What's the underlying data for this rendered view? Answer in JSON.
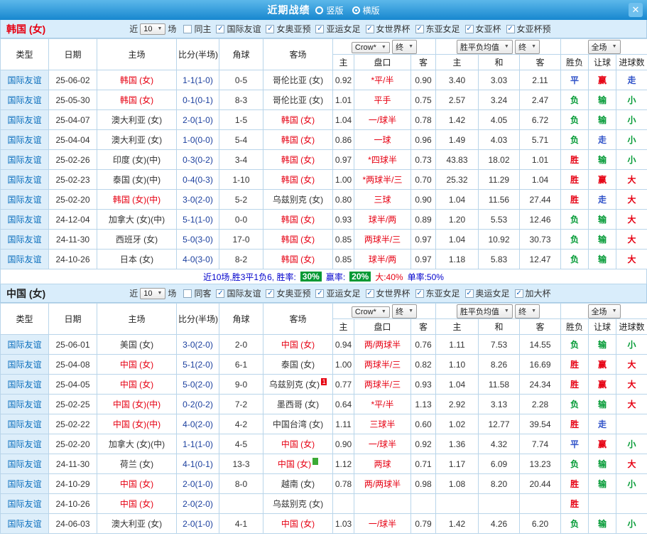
{
  "icons": {
    "close": "✕",
    "check": "✓",
    "dropdown_arrow": "▼"
  },
  "result_colors": {
    "胜": "#e60012",
    "负": "#009933",
    "平": "#2d50c8",
    "赢": "#e60012",
    "输": "#009933",
    "走": "#2d50c8",
    "大": "#e60012",
    "小": "#009933"
  },
  "titlebar": {
    "title": "近期战绩",
    "radios": [
      {
        "label": "竖版",
        "selected": false
      },
      {
        "label": "横版",
        "selected": true
      }
    ]
  },
  "sections": [
    {
      "team": "韩国 (女)",
      "team_color": "#e60012",
      "filter": {
        "prefix": "近",
        "count": "10",
        "suffix": "场",
        "checkboxes": [
          {
            "label": "同主",
            "checked": false
          },
          {
            "label": "国际友谊",
            "checked": true
          },
          {
            "label": "女奥亚预",
            "checked": true
          },
          {
            "label": "亚运女足",
            "checked": true
          },
          {
            "label": "女世界杯",
            "checked": true
          },
          {
            "label": "东亚女足",
            "checked": true
          },
          {
            "label": "女亚杯",
            "checked": true
          },
          {
            "label": "女亚杯预",
            "checked": true
          }
        ]
      },
      "controls": {
        "bookmaker": "Crow*",
        "final_a": "终",
        "europe_avg": "胜平负均值",
        "final_b": "终",
        "scope": "全场"
      },
      "columns": {
        "type": "类型",
        "date": "日期",
        "home": "主场",
        "score": "比分(半场)",
        "corner": "角球",
        "away": "客场",
        "asia": [
          "主",
          "盘口",
          "客"
        ],
        "europe": [
          "主",
          "和",
          "客"
        ],
        "result": [
          "胜负",
          "让球",
          "进球数"
        ]
      },
      "rows": [
        {
          "type": "国际友谊",
          "date": "25-06-02",
          "home": {
            "name": "韩国 (女)",
            "hl": true
          },
          "score": "1-1(1-0)",
          "corner": "0-5",
          "away": {
            "name": "哥伦比亚 (女)",
            "hl": false
          },
          "asia": [
            "0.92",
            "*平/半",
            "0.90"
          ],
          "europe": [
            "3.40",
            "3.03",
            "2.11"
          ],
          "results": [
            "平",
            "赢",
            "走"
          ]
        },
        {
          "type": "国际友谊",
          "date": "25-05-30",
          "home": {
            "name": "韩国 (女)",
            "hl": true
          },
          "score": "0-1(0-1)",
          "corner": "8-3",
          "away": {
            "name": "哥伦比亚 (女)",
            "hl": false
          },
          "asia": [
            "1.01",
            "平手",
            "0.75"
          ],
          "europe": [
            "2.57",
            "3.24",
            "2.47"
          ],
          "results": [
            "负",
            "输",
            "小"
          ]
        },
        {
          "type": "国际友谊",
          "date": "25-04-07",
          "home": {
            "name": "澳大利亚 (女)",
            "hl": false
          },
          "score": "2-0(1-0)",
          "corner": "1-5",
          "away": {
            "name": "韩国 (女)",
            "hl": true
          },
          "asia": [
            "1.04",
            "一/球半",
            "0.78"
          ],
          "europe": [
            "1.42",
            "4.05",
            "6.72"
          ],
          "results": [
            "负",
            "输",
            "小"
          ]
        },
        {
          "type": "国际友谊",
          "date": "25-04-04",
          "home": {
            "name": "澳大利亚 (女)",
            "hl": false
          },
          "score": "1-0(0-0)",
          "corner": "5-4",
          "away": {
            "name": "韩国 (女)",
            "hl": true
          },
          "asia": [
            "0.86",
            "一球",
            "0.96"
          ],
          "europe": [
            "1.49",
            "4.03",
            "5.71"
          ],
          "results": [
            "负",
            "走",
            "小"
          ]
        },
        {
          "type": "国际友谊",
          "date": "25-02-26",
          "home": {
            "name": "印度 (女)(中)",
            "hl": false
          },
          "score": "0-3(0-2)",
          "corner": "3-4",
          "away": {
            "name": "韩国 (女)",
            "hl": true
          },
          "asia": [
            "0.97",
            "*四球半",
            "0.73"
          ],
          "europe": [
            "43.83",
            "18.02",
            "1.01"
          ],
          "results": [
            "胜",
            "输",
            "小"
          ]
        },
        {
          "type": "国际友谊",
          "date": "25-02-23",
          "home": {
            "name": "泰国 (女)(中)",
            "hl": false
          },
          "score": "0-4(0-3)",
          "corner": "1-10",
          "away": {
            "name": "韩国 (女)",
            "hl": true
          },
          "asia": [
            "1.00",
            "*两球半/三",
            "0.70"
          ],
          "europe": [
            "25.32",
            "11.29",
            "1.04"
          ],
          "results": [
            "胜",
            "赢",
            "大"
          ]
        },
        {
          "type": "国际友谊",
          "date": "25-02-20",
          "home": {
            "name": "韩国 (女)(中)",
            "hl": true
          },
          "score": "3-0(2-0)",
          "corner": "5-2",
          "away": {
            "name": "乌兹别克 (女)",
            "hl": false
          },
          "asia": [
            "0.80",
            "三球",
            "0.90"
          ],
          "europe": [
            "1.04",
            "11.56",
            "27.44"
          ],
          "results": [
            "胜",
            "走",
            "大"
          ]
        },
        {
          "type": "国际友谊",
          "date": "24-12-04",
          "home": {
            "name": "加拿大 (女)(中)",
            "hl": false
          },
          "score": "5-1(1-0)",
          "corner": "0-0",
          "away": {
            "name": "韩国 (女)",
            "hl": true
          },
          "asia": [
            "0.93",
            "球半/两",
            "0.89"
          ],
          "europe": [
            "1.20",
            "5.53",
            "12.46"
          ],
          "results": [
            "负",
            "输",
            "大"
          ]
        },
        {
          "type": "国际友谊",
          "date": "24-11-30",
          "home": {
            "name": "西班牙 (女)",
            "hl": false
          },
          "score": "5-0(3-0)",
          "corner": "17-0",
          "away": {
            "name": "韩国 (女)",
            "hl": true
          },
          "asia": [
            "0.85",
            "两球半/三",
            "0.97"
          ],
          "europe": [
            "1.04",
            "10.92",
            "30.73"
          ],
          "results": [
            "负",
            "输",
            "大"
          ]
        },
        {
          "type": "国际友谊",
          "date": "24-10-26",
          "home": {
            "name": "日本 (女)",
            "hl": false
          },
          "score": "4-0(3-0)",
          "corner": "8-2",
          "away": {
            "name": "韩国 (女)",
            "hl": true
          },
          "asia": [
            "0.85",
            "球半/两",
            "0.97"
          ],
          "europe": [
            "1.18",
            "5.83",
            "12.47"
          ],
          "results": [
            "负",
            "输",
            "大"
          ]
        }
      ],
      "summary": {
        "lead": "近10场,胜3平1负6, 胜率:",
        "rate1": "30%",
        "mid": "赢率:",
        "rate2": "20%",
        "big": "大:40%",
        "single": "单率:50%"
      }
    },
    {
      "team": "中国 (女)",
      "team_color": "#222222",
      "filter": {
        "prefix": "近",
        "count": "10",
        "suffix": "场",
        "checkboxes": [
          {
            "label": "同客",
            "checked": false
          },
          {
            "label": "国际友谊",
            "checked": true
          },
          {
            "label": "女奥亚预",
            "checked": true
          },
          {
            "label": "亚运女足",
            "checked": true
          },
          {
            "label": "女世界杯",
            "checked": true
          },
          {
            "label": "东亚女足",
            "checked": true
          },
          {
            "label": "奥运女足",
            "checked": true
          },
          {
            "label": "加大杯",
            "checked": true
          }
        ]
      },
      "controls": {
        "bookmaker": "Crow*",
        "final_a": "终",
        "europe_avg": "胜平负均值",
        "final_b": "终",
        "scope": "全场"
      },
      "columns": {
        "type": "类型",
        "date": "日期",
        "home": "主场",
        "score": "比分(半场)",
        "corner": "角球",
        "away": "客场",
        "asia": [
          "主",
          "盘口",
          "客"
        ],
        "europe": [
          "主",
          "和",
          "客"
        ],
        "result": [
          "胜负",
          "让球",
          "进球数"
        ]
      },
      "rows": [
        {
          "type": "国际友谊",
          "date": "25-06-01",
          "home": {
            "name": "美国 (女)",
            "hl": false
          },
          "score": "3-0(2-0)",
          "corner": "2-0",
          "away": {
            "name": "中国 (女)",
            "hl": true
          },
          "asia": [
            "0.94",
            "两/两球半",
            "0.76"
          ],
          "europe": [
            "1.11",
            "7.53",
            "14.55"
          ],
          "results": [
            "负",
            "输",
            "小"
          ]
        },
        {
          "type": "国际友谊",
          "date": "25-04-08",
          "home": {
            "name": "中国 (女)",
            "hl": true
          },
          "score": "5-1(2-0)",
          "corner": "6-1",
          "away": {
            "name": "泰国 (女)",
            "hl": false
          },
          "asia": [
            "1.00",
            "两球半/三",
            "0.82"
          ],
          "europe": [
            "1.10",
            "8.26",
            "16.69"
          ],
          "results": [
            "胜",
            "赢",
            "大"
          ]
        },
        {
          "type": "国际友谊",
          "date": "25-04-05",
          "home": {
            "name": "中国 (女)",
            "hl": true
          },
          "score": "5-0(2-0)",
          "corner": "9-0",
          "away": {
            "name": "乌兹别克 (女)",
            "hl": false,
            "badge": {
              "text": "1",
              "bg": "#e60012",
              "fg": "#ffffff"
            }
          },
          "asia": [
            "0.77",
            "两球半/三",
            "0.93"
          ],
          "europe": [
            "1.04",
            "11.58",
            "24.34"
          ],
          "results": [
            "胜",
            "赢",
            "大"
          ]
        },
        {
          "type": "国际友谊",
          "date": "25-02-25",
          "home": {
            "name": "中国 (女)(中)",
            "hl": true
          },
          "score": "0-2(0-2)",
          "corner": "7-2",
          "away": {
            "name": "墨西哥 (女)",
            "hl": false
          },
          "asia": [
            "0.64",
            "*平/半",
            "1.13"
          ],
          "europe": [
            "2.92",
            "3.13",
            "2.28"
          ],
          "results": [
            "负",
            "输",
            "大"
          ]
        },
        {
          "type": "国际友谊",
          "date": "25-02-22",
          "home": {
            "name": "中国 (女)(中)",
            "hl": true
          },
          "score": "4-0(2-0)",
          "corner": "4-2",
          "away": {
            "name": "中国台湾 (女)",
            "hl": false
          },
          "asia": [
            "1.11",
            "三球半",
            "0.60"
          ],
          "europe": [
            "1.02",
            "12.77",
            "39.54"
          ],
          "results": [
            "胜",
            "走",
            ""
          ]
        },
        {
          "type": "国际友谊",
          "date": "25-02-20",
          "home": {
            "name": "加拿大 (女)(中)",
            "hl": false
          },
          "score": "1-1(1-0)",
          "corner": "4-5",
          "away": {
            "name": "中国 (女)",
            "hl": true
          },
          "asia": [
            "0.90",
            "一/球半",
            "0.92"
          ],
          "europe": [
            "1.36",
            "4.32",
            "7.74"
          ],
          "results": [
            "平",
            "赢",
            "小"
          ]
        },
        {
          "type": "国际友谊",
          "date": "24-11-30",
          "home": {
            "name": "荷兰 (女)",
            "hl": false
          },
          "score": "4-1(0-1)",
          "corner": "13-3",
          "away": {
            "name": "中国 (女)",
            "hl": true,
            "badge": {
              "text": "",
              "bg": "#3aaa35",
              "fg": "#ffffff"
            }
          },
          "asia": [
            "1.12",
            "两球",
            "0.71"
          ],
          "europe": [
            "1.17",
            "6.09",
            "13.23"
          ],
          "results": [
            "负",
            "输",
            "大"
          ]
        },
        {
          "type": "国际友谊",
          "date": "24-10-29",
          "home": {
            "name": "中国 (女)",
            "hl": true
          },
          "score": "2-0(1-0)",
          "corner": "8-0",
          "away": {
            "name": "越南 (女)",
            "hl": false
          },
          "asia": [
            "0.78",
            "两/两球半",
            "0.98"
          ],
          "europe": [
            "1.08",
            "8.20",
            "20.44"
          ],
          "results": [
            "胜",
            "输",
            "小"
          ]
        },
        {
          "type": "国际友谊",
          "date": "24-10-26",
          "home": {
            "name": "中国 (女)",
            "hl": true
          },
          "score": "2-0(2-0)",
          "corner": "",
          "away": {
            "name": "乌兹别克 (女)",
            "hl": false
          },
          "asia": [
            "",
            "",
            ""
          ],
          "europe": [
            "",
            "",
            ""
          ],
          "results": [
            "胜",
            "",
            ""
          ]
        },
        {
          "type": "国际友谊",
          "date": "24-06-03",
          "home": {
            "name": "澳大利亚 (女)",
            "hl": false
          },
          "score": "2-0(1-0)",
          "corner": "4-1",
          "away": {
            "name": "中国 (女)",
            "hl": true
          },
          "asia": [
            "1.03",
            "一/球半",
            "0.79"
          ],
          "europe": [
            "1.42",
            "4.26",
            "6.20"
          ],
          "results": [
            "负",
            "输",
            "小"
          ]
        }
      ],
      "summary": null
    }
  ]
}
